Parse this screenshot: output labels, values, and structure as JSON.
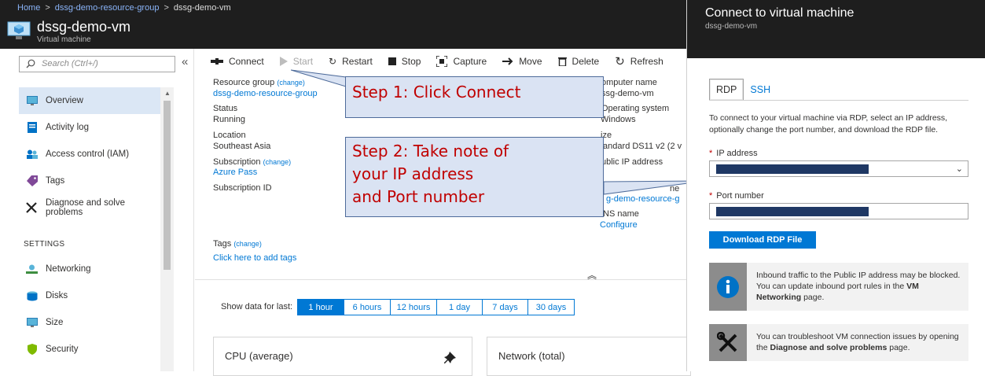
{
  "breadcrumb": {
    "home": "Home",
    "group": "dssg-demo-resource-group",
    "current": "dssg-demo-vm"
  },
  "vm": {
    "title": "dssg-demo-vm",
    "subtitle": "Virtual machine"
  },
  "search": {
    "placeholder": "Search (Ctrl+/)"
  },
  "nav": {
    "items": [
      {
        "label": "Overview",
        "icon": "monitor-icon"
      },
      {
        "label": "Activity log",
        "icon": "activity-log-icon"
      },
      {
        "label": "Access control (IAM)",
        "icon": "people-icon"
      },
      {
        "label": "Tags",
        "icon": "tag-icon"
      },
      {
        "label": "Diagnose and solve problems",
        "icon": "wrench-icon"
      }
    ],
    "settings_header": "SETTINGS",
    "settings_items": [
      {
        "label": "Networking",
        "icon": "network-icon"
      },
      {
        "label": "Disks",
        "icon": "disks-icon"
      },
      {
        "label": "Size",
        "icon": "size-icon"
      },
      {
        "label": "Security",
        "icon": "shield-icon"
      }
    ]
  },
  "toolbar": {
    "connect": "Connect",
    "start": "Start",
    "restart": "Restart",
    "stop": "Stop",
    "capture": "Capture",
    "move": "Move",
    "delete": "Delete",
    "refresh": "Refresh"
  },
  "essentials": {
    "resource_group_label": "Resource group",
    "change": "(change)",
    "resource_group_value": "dssg-demo-resource-group",
    "status_label": "Status",
    "status_value": "Running",
    "location_label": "Location",
    "location_value": "Southeast Asia",
    "subscription_label": "Subscription",
    "subscription_value": "Azure Pass",
    "subscription_id_label": "Subscription ID",
    "computer_name_label": "omputer name",
    "computer_name_value": "ssg-demo-vm",
    "os_label": "Operating system",
    "os_value": "Windows",
    "size_label": "ize",
    "size_value": "tandard DS11 v2 (2 v",
    "public_ip_label": "ublic IP address",
    "vnet_label": "ne",
    "vnet_value": "g-demo-resource-g",
    "dns_label": "NS name",
    "dns_value": "Configure",
    "tags_label": "Tags",
    "tags_add": "Click here to add tags"
  },
  "timerange": {
    "label": "Show data for last:",
    "options": [
      "1 hour",
      "6 hours",
      "12 hours",
      "1 day",
      "7 days",
      "30 days"
    ]
  },
  "cards": {
    "cpu": "CPU (average)",
    "network": "Network (total)"
  },
  "callouts": {
    "step1": "Step 1: Click Connect",
    "step2_line1": "Step 2: Take note of",
    "step2_line2": "your IP address",
    "step2_line3": "and Port number"
  },
  "panel": {
    "title": "Connect to virtual machine",
    "subtitle": "dssg-demo-vm",
    "tabs": [
      "RDP",
      "SSH"
    ],
    "description": "To connect to your virtual machine via RDP, select an IP address, optionally change the port number, and download the RDP file.",
    "ip_label": "IP address",
    "port_label": "Port number",
    "download_button": "Download RDP File",
    "info1_a": "Inbound traffic to the Public IP address may be blocked. You can update inbound port rules in the ",
    "info1_b": "VM Networking",
    "info1_c": " page.",
    "info2_a": "You can troubleshoot VM connection issues by opening the ",
    "info2_b": "Diagnose and solve problems",
    "info2_c": " page."
  },
  "colors": {
    "accent": "#0078d4",
    "callout_bg": "#dae3f3",
    "callout_text": "#c00000",
    "header_bg": "#1e1e1e"
  }
}
